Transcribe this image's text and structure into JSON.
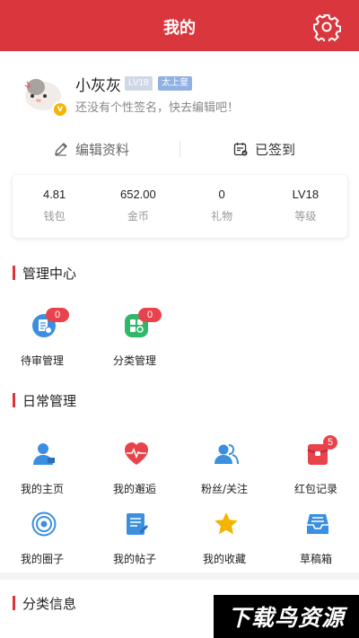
{
  "header": {
    "title": "我的"
  },
  "profile": {
    "username": "小灰灰",
    "level_tag": "LV18",
    "title_tag": "太上皇",
    "signature": "还没有个性签名，快去编辑吧！"
  },
  "actions": {
    "edit_label": "编辑资料",
    "signed_label": "已签到"
  },
  "stats": [
    {
      "value": "4.81",
      "label": "钱包"
    },
    {
      "value": "652.00",
      "label": "金币"
    },
    {
      "value": "0",
      "label": "礼物"
    },
    {
      "value": "LV18",
      "label": "等级"
    }
  ],
  "management": {
    "title": "管理中心",
    "items": [
      {
        "label": "待审管理",
        "badge": "0",
        "icon": "review-doc-icon"
      },
      {
        "label": "分类管理",
        "badge": "0",
        "icon": "category-manage-icon"
      }
    ]
  },
  "daily": {
    "title": "日常管理",
    "items": [
      {
        "label": "我的主页",
        "icon": "user-home-icon"
      },
      {
        "label": "我的邂逅",
        "icon": "heartbeat-icon"
      },
      {
        "label": "粉丝/关注",
        "icon": "fans-icon"
      },
      {
        "label": "红包记录",
        "icon": "red-packet-icon",
        "badge": "5"
      },
      {
        "label": "我的圈子",
        "icon": "circle-target-icon"
      },
      {
        "label": "我的帖子",
        "icon": "post-edit-icon"
      },
      {
        "label": "我的收藏",
        "icon": "star-icon"
      },
      {
        "label": "草稿箱",
        "icon": "draft-box-icon"
      }
    ]
  },
  "category_info": {
    "title": "分类信息"
  },
  "watermark": {
    "text": "下载鸟资源"
  },
  "colors": {
    "brand": "#d9363e",
    "badge": "#e8434b",
    "blue": "#3b8fe0",
    "star": "#f5b400"
  }
}
